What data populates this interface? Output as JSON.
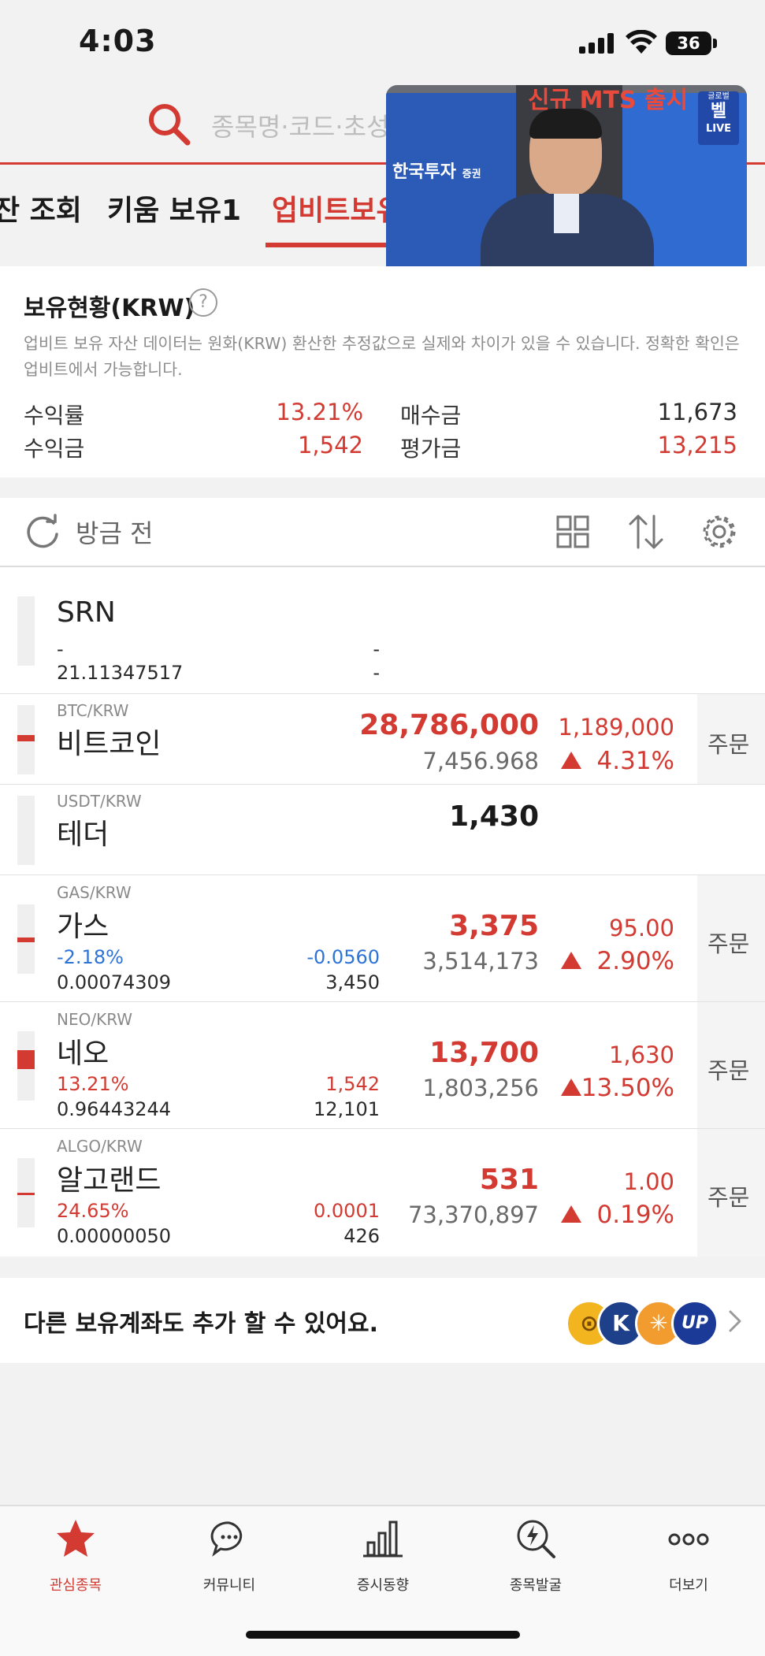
{
  "status_bar": {
    "time": "4:03",
    "battery": "36"
  },
  "search": {
    "placeholder": "종목명·코드·초성"
  },
  "tabs": [
    {
      "label": "잔 조회"
    },
    {
      "label": "키움 보유1"
    },
    {
      "label": "업비트보유"
    }
  ],
  "video": {
    "banner": "신규 MTS 출시",
    "brand": "한국투자",
    "brand_suffix": "증권",
    "badge_line1": "글로벌",
    "badge_line2": "벨",
    "badge_live": "LIVE"
  },
  "holdings": {
    "title": "보유현황(KRW)",
    "help": "?",
    "note": "업비트 보유 자산 데이터는 원화(KRW) 환산한 추정값으로 실제와 차이가 있을 수 있습니다. 정확한 확인은 업비트에서 가능합니다.",
    "return_rate_label": "수익률",
    "return_rate": "13.21%",
    "profit_label": "수익금",
    "profit": "1,542",
    "purchase_label": "매수금",
    "purchase": "11,673",
    "valuation_label": "평가금",
    "valuation": "13,215"
  },
  "toolbar": {
    "refresh_label": "방금 전"
  },
  "rows": [
    {
      "name": "SRN",
      "line1_left": "-",
      "line1_right": "-",
      "qty": "21.11347517",
      "qty_right": "-"
    },
    {
      "pair": "BTC/KRW",
      "name": "비트코인",
      "price": "28,786,000",
      "volume": "7,456.968",
      "change": "1,189,000",
      "rate": "4.31%",
      "order": "주문"
    },
    {
      "pair": "USDT/KRW",
      "name": "테더",
      "price": "1,430"
    },
    {
      "pair": "GAS/KRW",
      "name": "가스",
      "pl_rate": "-2.18%",
      "pl_amount": "-0.0560",
      "qty": "0.00074309",
      "eval": "3,450",
      "price": "3,375",
      "volume": "3,514,173",
      "change": "95.00",
      "rate": "2.90%",
      "order": "주문"
    },
    {
      "pair": "NEO/KRW",
      "name": "네오",
      "pl_rate": "13.21%",
      "pl_amount": "1,542",
      "qty": "0.96443244",
      "eval": "12,101",
      "price": "13,700",
      "volume": "1,803,256",
      "change": "1,630",
      "rate": "13.50%",
      "order": "주문"
    },
    {
      "pair": "ALGO/KRW",
      "name": "알고랜드",
      "pl_rate": "24.65%",
      "pl_amount": "0.0001",
      "qty": "0.00000050",
      "eval": "426",
      "price": "531",
      "volume": "73,370,897",
      "change": "1.00",
      "rate": "0.19%",
      "order": "주문"
    }
  ],
  "add_account": {
    "text": "다른 보유계좌도 추가 할 수 있어요.",
    "logo_k": "K",
    "logo_up": "UP"
  },
  "bottom_nav": [
    {
      "label": "관심종목"
    },
    {
      "label": "커뮤니티"
    },
    {
      "label": "증시동향"
    },
    {
      "label": "종목발굴"
    },
    {
      "label": "더보기"
    }
  ],
  "colors": {
    "accent_red": "#d23a32",
    "down_blue": "#2e73d6",
    "background": "#f2f2f2"
  }
}
